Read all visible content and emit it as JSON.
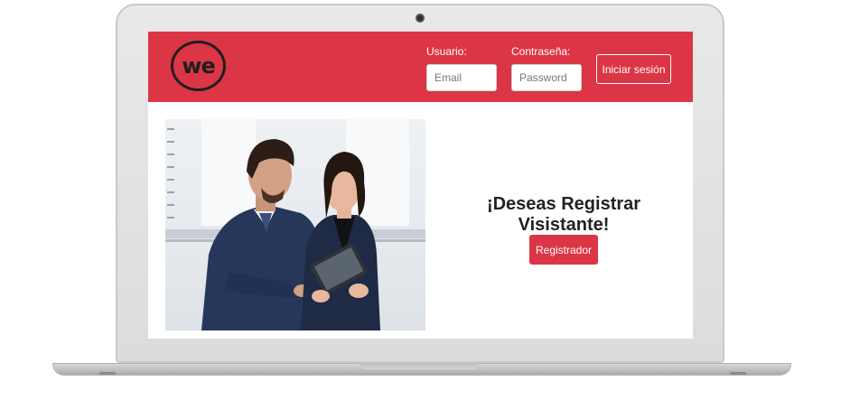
{
  "header": {
    "logo_text": "we",
    "user_label": "Usuario:",
    "email_placeholder": "Email",
    "password_label": "Contraseña:",
    "password_placeholder": "Password",
    "login_button": "Iniciar sesión"
  },
  "main": {
    "headline": "¡Deseas Registrar Visistante!",
    "register_button": "Registrador"
  },
  "colors": {
    "brand_red": "#dc3545",
    "text_dark": "#222222"
  },
  "icons": [
    "we-logo-icon",
    "webcam-icon"
  ]
}
